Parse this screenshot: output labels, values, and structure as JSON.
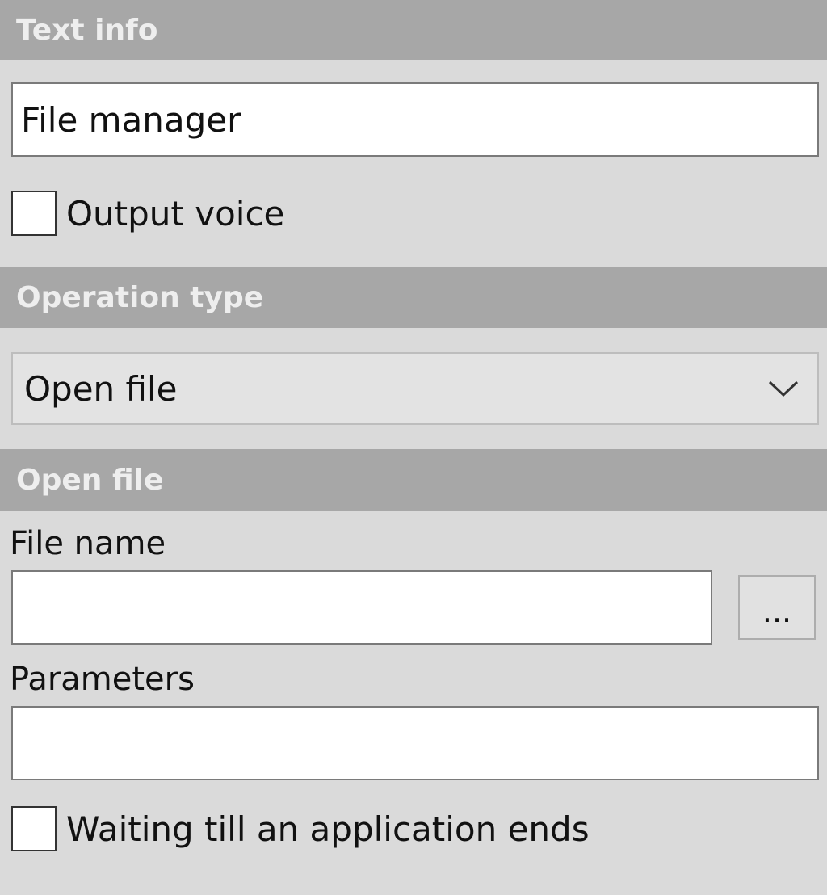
{
  "text_info": {
    "header": "Text info",
    "text_value": "File manager",
    "output_voice_label": "Output voice",
    "output_voice_checked": false
  },
  "operation_type": {
    "header": "Operation type",
    "selected": "Open file"
  },
  "open_file": {
    "header": "Open file",
    "file_name_label": "File name",
    "file_name_value": "",
    "browse_label": "...",
    "parameters_label": "Parameters",
    "parameters_value": "",
    "wait_label": "Waiting till an application ends",
    "wait_checked": false
  }
}
